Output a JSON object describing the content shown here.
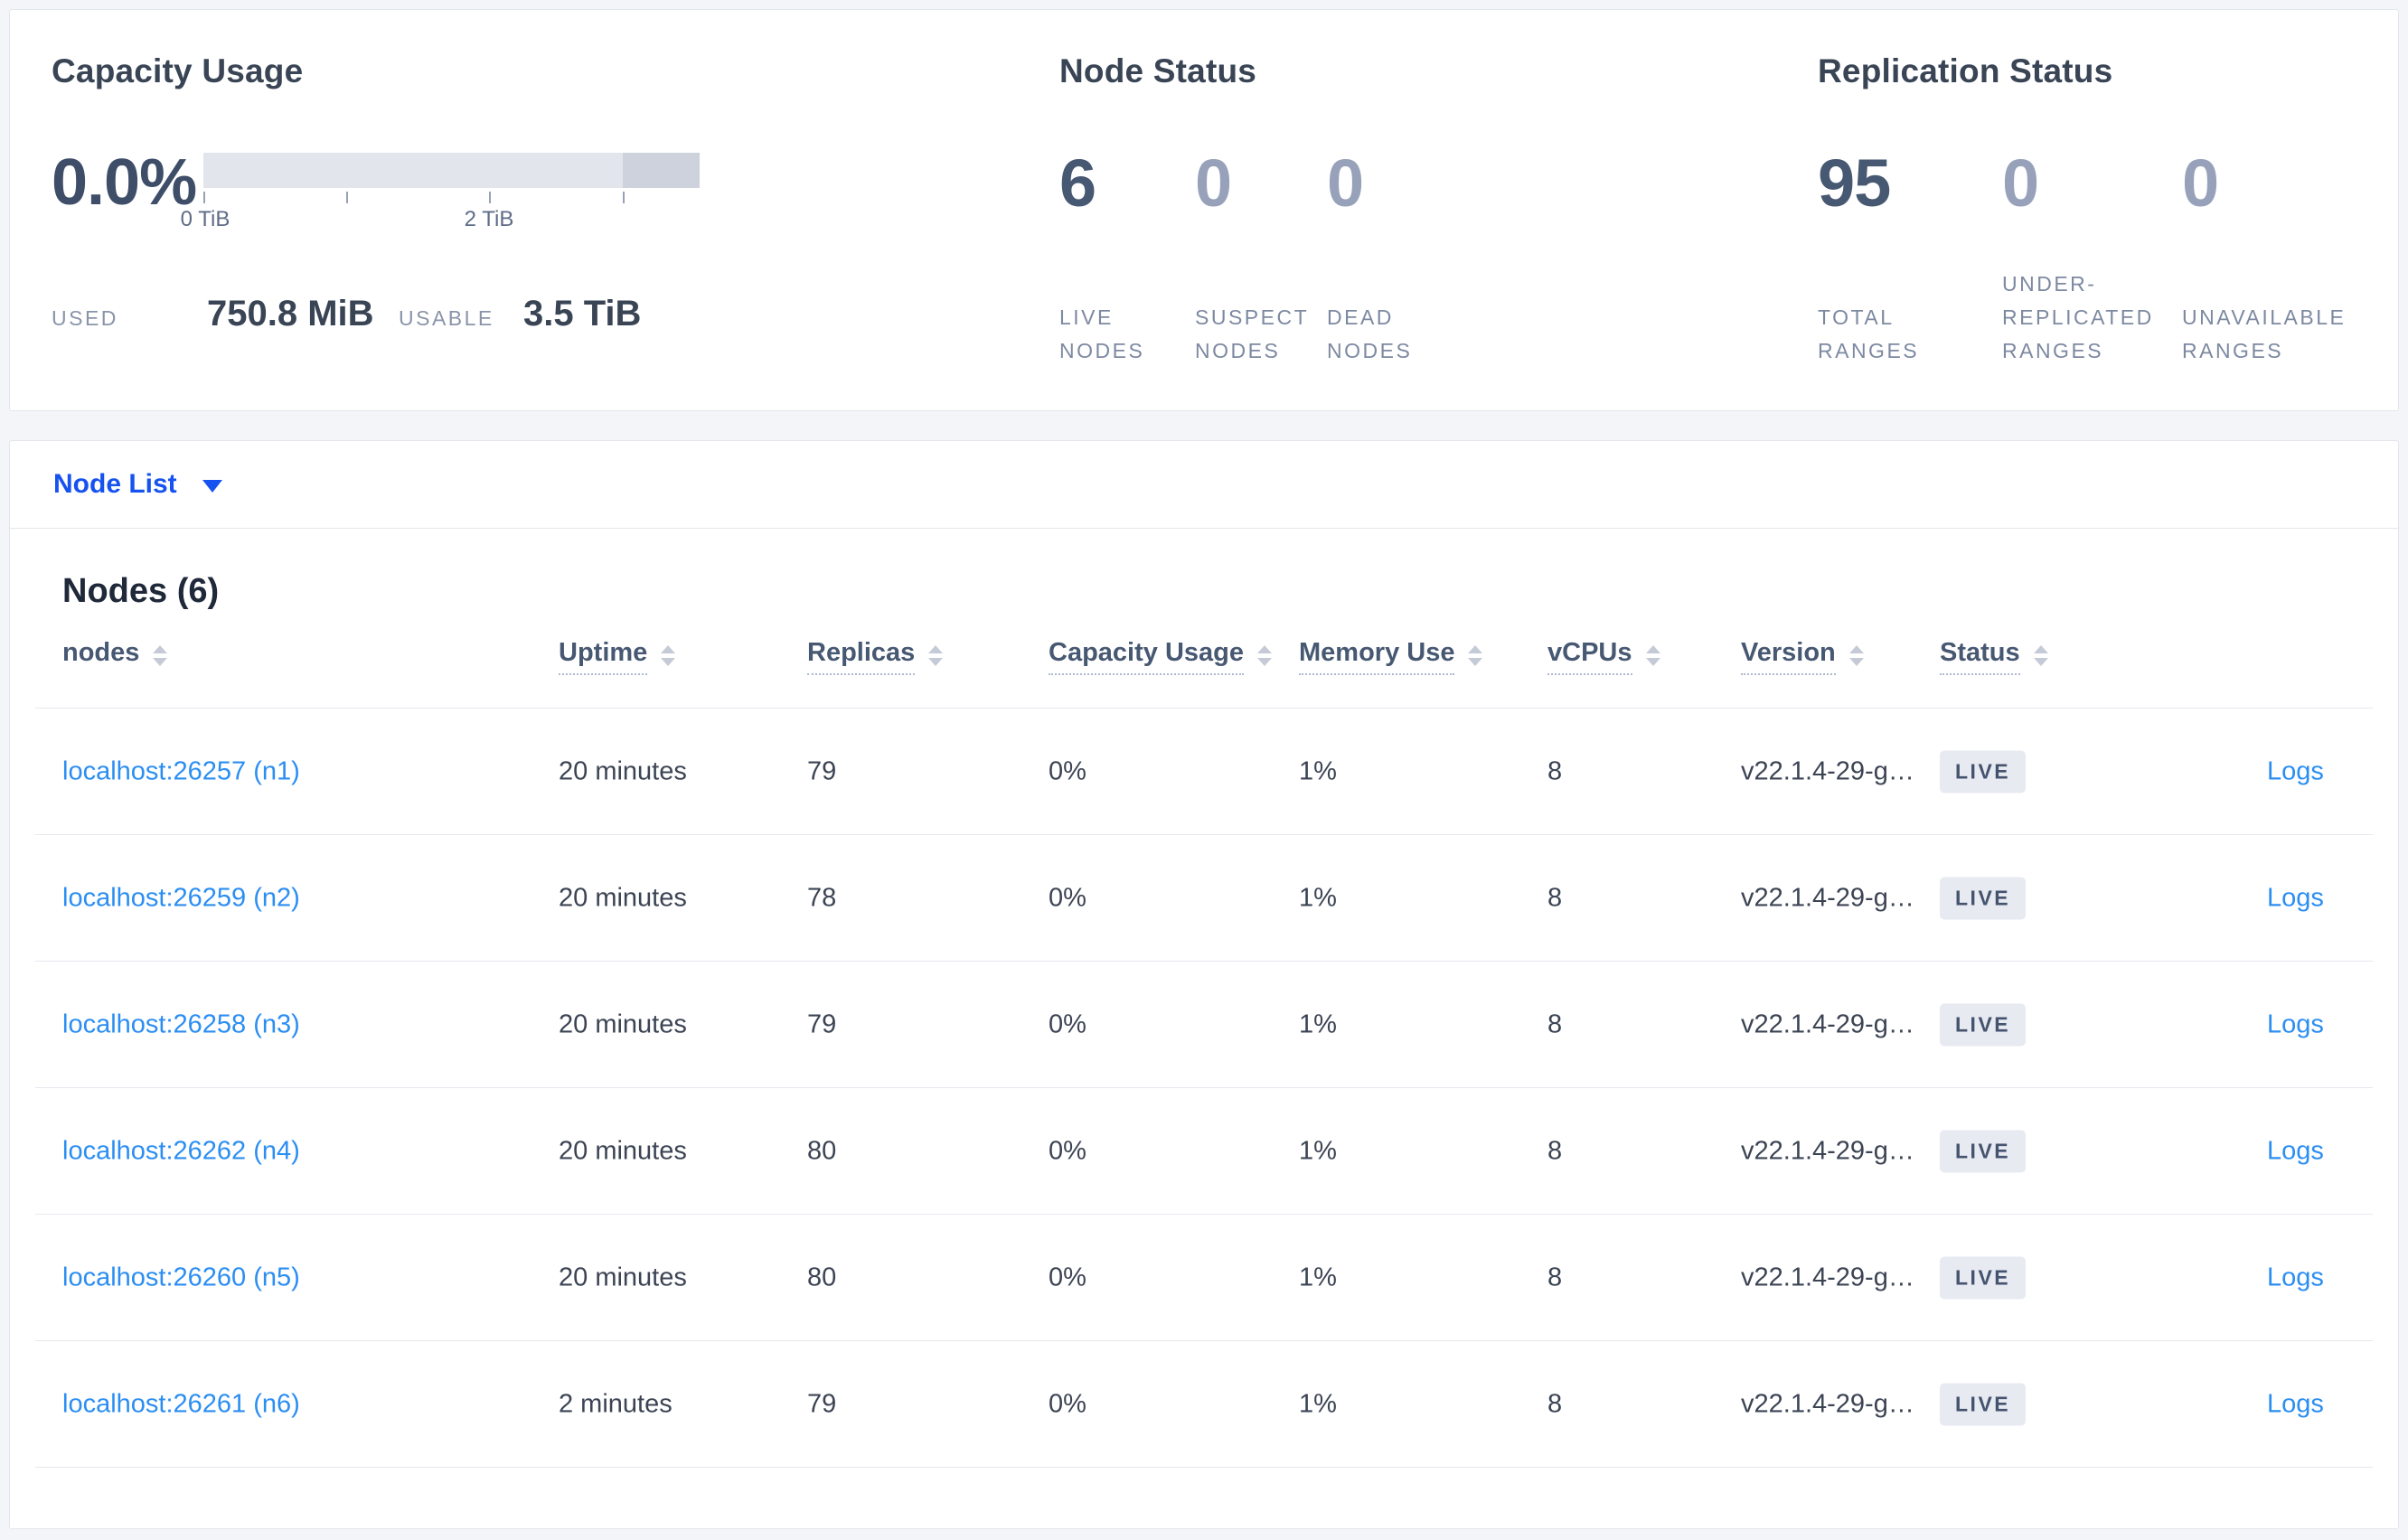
{
  "summary": {
    "capacity": {
      "title": "Capacity Usage",
      "percent": "0.0%",
      "used_label": "USED",
      "used_value": "750.8 MiB",
      "usable_label": "USABLE",
      "usable_value": "3.5 TiB",
      "tick_label_start": "0 TiB",
      "tick_label_mid": "2 TiB"
    },
    "node_status": {
      "title": "Node Status",
      "live": {
        "value": "6",
        "label": "LIVE NODES"
      },
      "suspect": {
        "value": "0",
        "label": "SUSPECT NODES"
      },
      "dead": {
        "value": "0",
        "label": "DEAD NODES"
      }
    },
    "replication": {
      "title": "Replication Status",
      "total": {
        "value": "95",
        "label": "TOTAL RANGES"
      },
      "under_replicated": {
        "value": "0",
        "label": "UNDER-REPLICATED RANGES"
      },
      "unavailable": {
        "value": "0",
        "label": "UNAVAILABLE RANGES"
      }
    }
  },
  "node_list": {
    "selector_label": "Node List"
  },
  "table": {
    "title": "Nodes (6)",
    "headers": {
      "nodes": "nodes",
      "uptime": "Uptime",
      "replicas": "Replicas",
      "capacity": "Capacity Usage",
      "memory": "Memory Use",
      "vcpus": "vCPUs",
      "version": "Version",
      "status": "Status"
    },
    "rows": [
      {
        "name": "localhost:26257 (n1)",
        "uptime": "20 minutes",
        "replicas": "79",
        "capacity": "0%",
        "memory": "1%",
        "vcpus": "8",
        "version": "v22.1.4-29-g…",
        "status": "LIVE",
        "logs": "Logs"
      },
      {
        "name": "localhost:26259 (n2)",
        "uptime": "20 minutes",
        "replicas": "78",
        "capacity": "0%",
        "memory": "1%",
        "vcpus": "8",
        "version": "v22.1.4-29-g…",
        "status": "LIVE",
        "logs": "Logs"
      },
      {
        "name": "localhost:26258 (n3)",
        "uptime": "20 minutes",
        "replicas": "79",
        "capacity": "0%",
        "memory": "1%",
        "vcpus": "8",
        "version": "v22.1.4-29-g…",
        "status": "LIVE",
        "logs": "Logs"
      },
      {
        "name": "localhost:26262 (n4)",
        "uptime": "20 minutes",
        "replicas": "80",
        "capacity": "0%",
        "memory": "1%",
        "vcpus": "8",
        "version": "v22.1.4-29-g…",
        "status": "LIVE",
        "logs": "Logs"
      },
      {
        "name": "localhost:26260 (n5)",
        "uptime": "20 minutes",
        "replicas": "80",
        "capacity": "0%",
        "memory": "1%",
        "vcpus": "8",
        "version": "v22.1.4-29-g…",
        "status": "LIVE",
        "logs": "Logs"
      },
      {
        "name": "localhost:26261 (n6)",
        "uptime": "2 minutes",
        "replicas": "79",
        "capacity": "0%",
        "memory": "1%",
        "vcpus": "8",
        "version": "v22.1.4-29-g…",
        "status": "LIVE",
        "logs": "Logs"
      }
    ]
  },
  "colors": {
    "primary_link_blue": "#1652f0",
    "node_link_blue": "#2b8ef2",
    "bar_fill_light": "#e3e5ec",
    "bar_fill_dark": "#cdd2dc",
    "live_badge_bg": "#e7eaf1",
    "slate_text": "#475872"
  }
}
